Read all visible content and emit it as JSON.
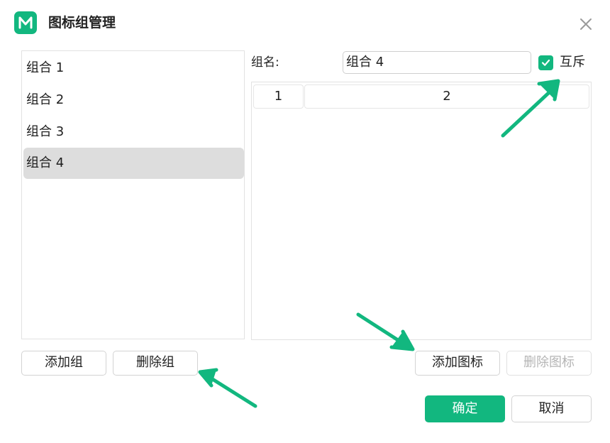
{
  "window": {
    "title": "图标组管理"
  },
  "groups": [
    {
      "label": "组合 1"
    },
    {
      "label": "组合 2"
    },
    {
      "label": "组合 3"
    },
    {
      "label": "组合 4"
    }
  ],
  "selected_group_index": 3,
  "detail": {
    "name_label": "组名:",
    "name_value": "组合 4",
    "mutex_label": "互斥",
    "mutex_checked": true,
    "columns": [
      "1",
      "2"
    ]
  },
  "buttons": {
    "add_group": "添加组",
    "delete_group": "删除组",
    "add_icon": "添加图标",
    "delete_icon": "删除图标",
    "ok": "确定",
    "cancel": "取消"
  },
  "colors": {
    "accent": "#12b77f",
    "selected_row": "#dddddd",
    "annotation_arrow": "#12b77f"
  },
  "icons": {
    "logo": "mindmaster-logo-icon",
    "close": "close-icon",
    "check": "check-icon",
    "arrow": "annotation-arrow"
  }
}
